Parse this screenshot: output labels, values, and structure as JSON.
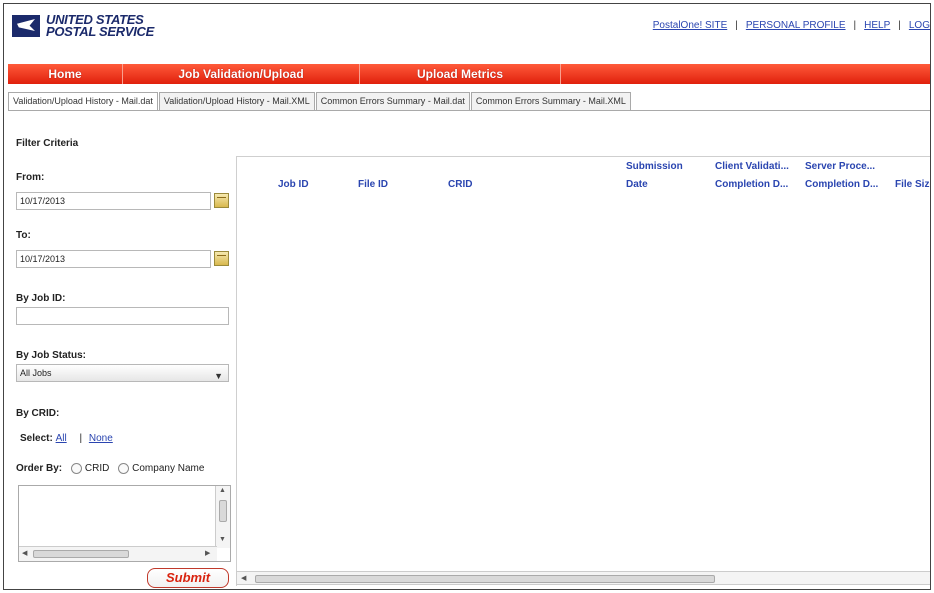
{
  "header": {
    "logo_line1": "UNITED STATES",
    "logo_line2": "POSTAL SERVICE",
    "links": [
      "PostalOne! SITE",
      "PERSONAL PROFILE",
      "HELP",
      "LOG"
    ]
  },
  "nav": [
    "Home",
    "Job Validation/Upload",
    "Upload Metrics"
  ],
  "tabs": [
    "Validation/Upload History - Mail.dat",
    "Validation/Upload History - Mail.XML",
    "Common Errors Summary - Mail.dat",
    "Common Errors Summary - Mail.XML"
  ],
  "filter": {
    "title": "Filter Criteria",
    "from_label": "From:",
    "from_value": "10/17/2013",
    "to_label": "To:",
    "to_value": "10/17/2013",
    "jobid_label": "By Job ID:",
    "jobid_value": "",
    "status_label": "By Job Status:",
    "status_value": "All Jobs",
    "crid_label": "By CRID:",
    "select_label": "Select:",
    "select_all": "All",
    "select_sep": "|",
    "select_none": "None",
    "order_label": "Order By:",
    "order_crid": "CRID",
    "order_company": "Company Name",
    "submit_label": "Submit"
  },
  "grid": {
    "columns": [
      "Job ID",
      "File ID",
      "CRID",
      "Submission",
      "Date",
      "Client Validati...",
      "Completion D...",
      "Server Proce...",
      "Completion D...",
      "File Size"
    ]
  },
  "colors": {
    "nav_red": "#e0200c",
    "link_blue": "#2a45b0",
    "usps_blue": "#1b2a6b"
  }
}
